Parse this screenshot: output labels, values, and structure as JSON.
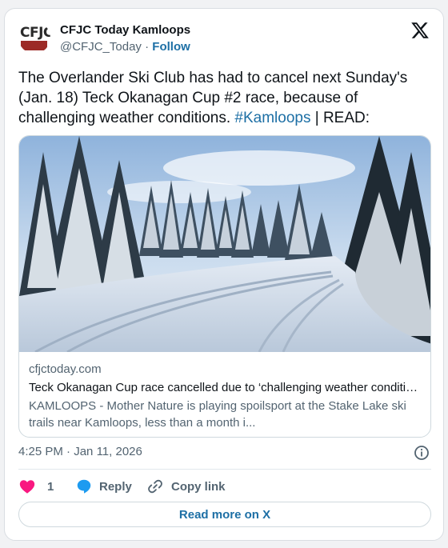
{
  "account": {
    "name": "CFJC Today Kamloops",
    "handle": "@CFJC_Today",
    "separator": "·",
    "follow_label": "Follow",
    "avatar_logo_text": "CFJC"
  },
  "tweet": {
    "text_before_hashtag": "The Overlander Ski Club has had to cancel next Sunday's (Jan. 18) Teck Okanagan Cup #2 race, because of challenging weather conditions.",
    "hashtag": "#Kamloops",
    "text_after_hashtag": "| READ:"
  },
  "link_card": {
    "domain": "cfjctoday.com",
    "title": "Teck Okanagan Cup race cancelled due to ‘challenging weather conditi…",
    "description": "KAMLOOPS - Mother Nature is playing spoilsport at the Stake Lake ski trails near Kamloops, less than a month i..."
  },
  "meta": {
    "time": "4:25 PM",
    "separator": "·",
    "date": "Jan 11, 2026"
  },
  "actions": {
    "like_count": "1",
    "reply_label": "Reply",
    "copy_link_label": "Copy link"
  },
  "read_more_label": "Read more on X",
  "colors": {
    "accent": "#1d6fa5",
    "like": "#f91880",
    "reply_icon": "#1d9bf0",
    "secondary_text": "#536471"
  },
  "icons": [
    "cfjc-logo",
    "x-logo-icon",
    "info-icon",
    "heart-icon",
    "reply-bubble-icon",
    "link-icon"
  ]
}
